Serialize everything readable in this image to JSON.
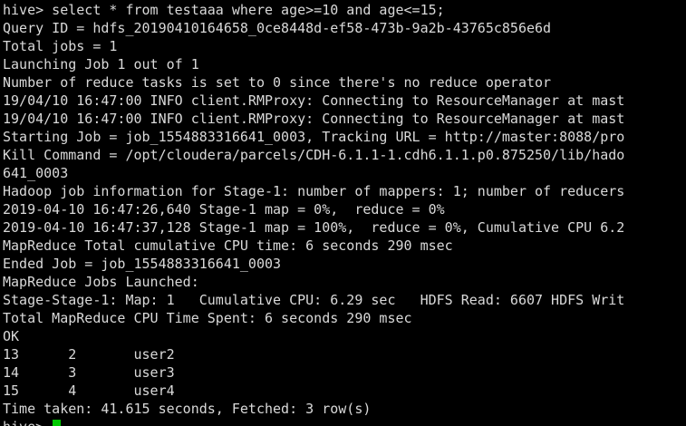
{
  "terminal": {
    "text_color": "#d9d9d9",
    "background_color": "#000000",
    "cursor_color": "#00c800",
    "lines": [
      "hive> select * from testaaa where age>=10 and age<=15;",
      "Query ID = hdfs_20190410164658_0ce8448d-ef58-473b-9a2b-43765c856e6d",
      "Total jobs = 1",
      "Launching Job 1 out of 1",
      "Number of reduce tasks is set to 0 since there's no reduce operator",
      "19/04/10 16:47:00 INFO client.RMProxy: Connecting to ResourceManager at mast",
      "19/04/10 16:47:00 INFO client.RMProxy: Connecting to ResourceManager at mast",
      "Starting Job = job_1554883316641_0003, Tracking URL = http://master:8088/pro",
      "Kill Command = /opt/cloudera/parcels/CDH-6.1.1-1.cdh6.1.1.p0.875250/lib/hado",
      "641_0003",
      "Hadoop job information for Stage-1: number of mappers: 1; number of reducers",
      "2019-04-10 16:47:26,640 Stage-1 map = 0%,  reduce = 0%",
      "2019-04-10 16:47:37,128 Stage-1 map = 100%,  reduce = 0%, Cumulative CPU 6.2",
      "MapReduce Total cumulative CPU time: 6 seconds 290 msec",
      "Ended Job = job_1554883316641_0003",
      "MapReduce Jobs Launched:",
      "Stage-Stage-1: Map: 1   Cumulative CPU: 6.29 sec   HDFS Read: 6607 HDFS Writ",
      "Total MapReduce CPU Time Spent: 6 seconds 290 msec",
      "OK",
      "13      2       user2",
      "14      3       user3",
      "15      4       user4",
      "Time taken: 41.615 seconds, Fetched: 3 row(s)"
    ],
    "prompt": "hive> "
  }
}
